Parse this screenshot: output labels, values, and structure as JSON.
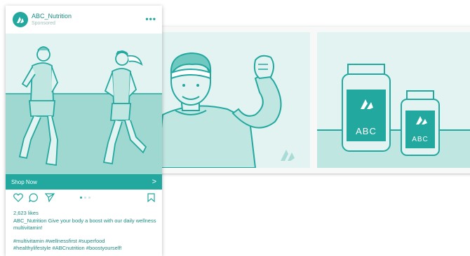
{
  "post": {
    "account": "ABC_Nutrition",
    "sponsored": "Sponsored",
    "more_icon": "more-dots-icon",
    "cta_label": "Shop Now",
    "cta_arrow": ">",
    "likes": "2,623 likes",
    "caption_account": "ABC_Nutrition",
    "caption_text": "Give your body a boost with our daily wellness multivitamin!",
    "hashtags_line1": "#multivitamin #wellnessfirst #superfood",
    "hashtags_line2": "#healthylifestyle #ABCnutrition #boostyourself!",
    "carousel_dots": 3,
    "active_dot": 0
  },
  "products": {
    "bottle_large_label": "ABC",
    "bottle_small_label": "ABC"
  },
  "colors": {
    "accent": "#22a89f",
    "background_tint": "#e3f3f1",
    "floor": "#a9dcd6"
  },
  "icons": [
    "heart-icon",
    "comment-icon",
    "share-icon",
    "bookmark-icon",
    "brand-logo-icon",
    "chevron-right-icon"
  ]
}
